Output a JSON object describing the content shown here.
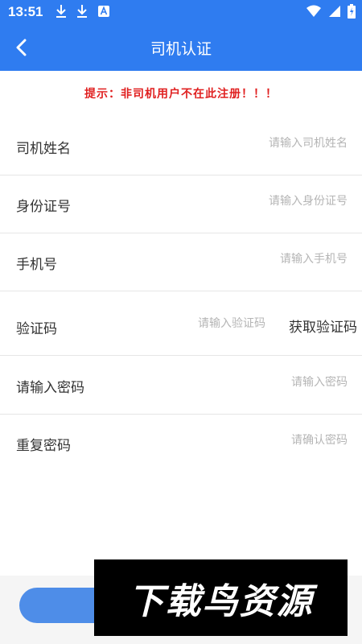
{
  "status_bar": {
    "time": "13:51",
    "left_icons": [
      "download-icon",
      "download-icon",
      "a-icon"
    ],
    "right_icons": [
      "wifi-icon",
      "signal-icon",
      "battery-icon"
    ]
  },
  "nav": {
    "title": "司机认证",
    "back_icon": "chevron-left-icon"
  },
  "notice": "提示：非司机用户不在此注册！！！",
  "form": {
    "name": {
      "label": "司机姓名",
      "placeholder": "请输入司机姓名"
    },
    "id_number": {
      "label": "身份证号",
      "placeholder": "请输入身份证号"
    },
    "phone": {
      "label": "手机号",
      "placeholder": "请输入手机号"
    },
    "code": {
      "label": "验证码",
      "placeholder": "请输入验证码",
      "button": "获取验证码"
    },
    "password": {
      "label": "请输入密码",
      "placeholder": "请输入密码"
    },
    "confirm_password": {
      "label": "重复密码",
      "placeholder": "请确认密码"
    }
  },
  "watermark": "下载鸟资源",
  "colors": {
    "primary": "#2f7cf0",
    "notice": "#e02020",
    "button": "#4e8de8"
  }
}
